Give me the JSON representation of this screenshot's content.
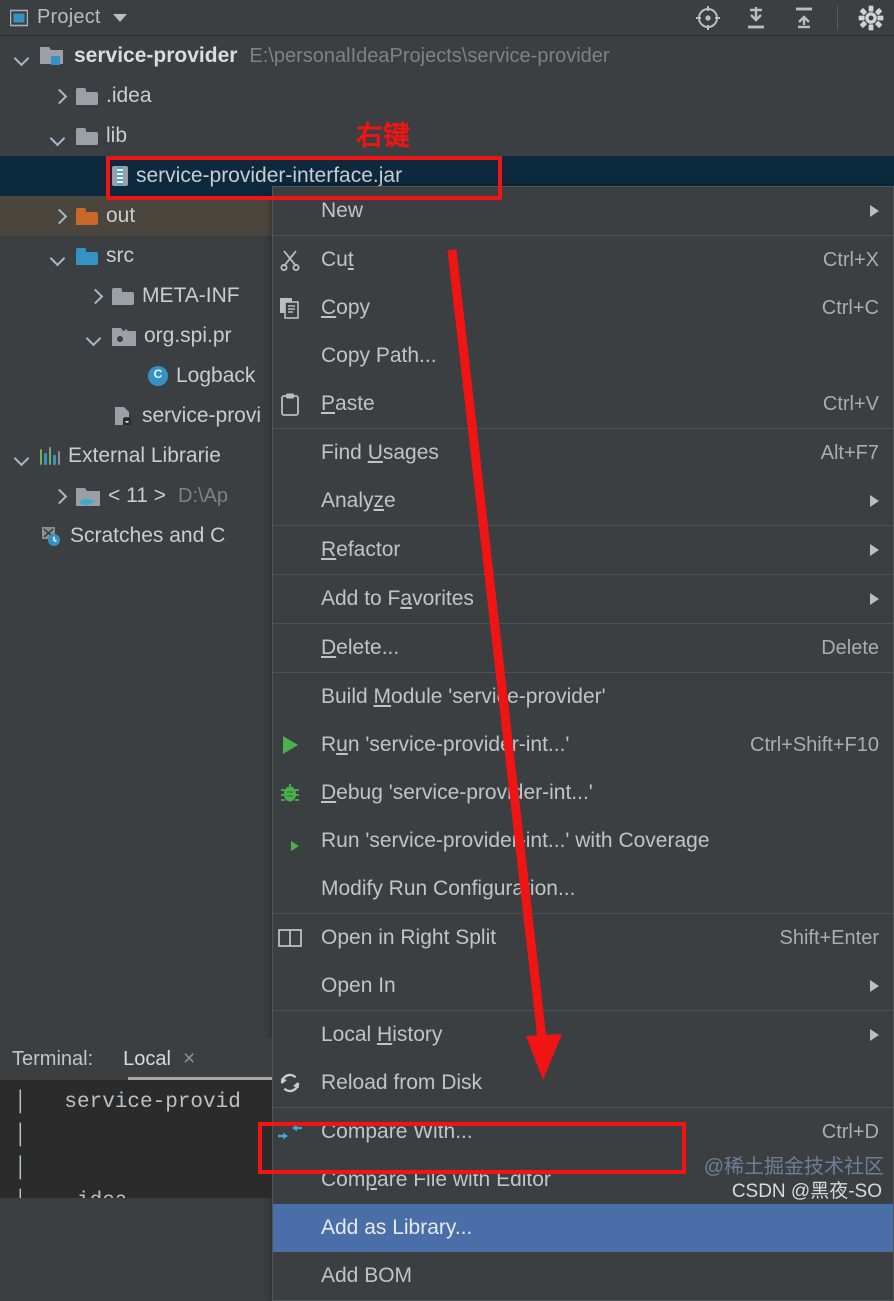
{
  "panel": {
    "title": "Project",
    "icon": "project-window-icon",
    "toolbar": [
      {
        "name": "locate-in-tree-icon",
        "label": "Select Opened File"
      },
      {
        "name": "expand-all-icon",
        "label": "Expand All"
      },
      {
        "name": "collapse-all-icon",
        "label": "Collapse All"
      },
      {
        "name": "settings-gear-icon",
        "label": "Options"
      }
    ]
  },
  "tree": [
    {
      "label": "service-provider",
      "secondary": "E:\\personalIdeaProjects\\service-provider",
      "indent": 0,
      "twisty": "down",
      "icon": "module-folder-icon",
      "bold": true,
      "squiggly": true
    },
    {
      "label": ".idea",
      "secondary": "",
      "indent": 1,
      "twisty": "right",
      "icon": "folder-icon",
      "bold": false,
      "squiggly": false
    },
    {
      "label": "lib",
      "secondary": "",
      "indent": 1,
      "twisty": "down",
      "icon": "folder-icon",
      "bold": false,
      "squiggly": false
    },
    {
      "label": "service-provider-interface.jar",
      "secondary": "",
      "indent": 2,
      "twisty": "none",
      "icon": "jar-file-icon",
      "bold": false,
      "squiggly": false,
      "selected": true
    },
    {
      "label": "out",
      "secondary": "",
      "indent": 1,
      "twisty": "right",
      "icon": "excluded-folder-icon",
      "bold": false,
      "squiggly": false,
      "highlighted": true
    },
    {
      "label": "src",
      "secondary": "",
      "indent": 1,
      "twisty": "down",
      "icon": "source-folder-icon",
      "bold": false,
      "squiggly": true
    },
    {
      "label": "META-INF",
      "secondary": "",
      "indent": 2,
      "twisty": "right",
      "icon": "folder-icon",
      "bold": false,
      "squiggly": false
    },
    {
      "label": "org.spi.pr",
      "secondary": "",
      "indent": 2,
      "twisty": "down",
      "icon": "package-folder-icon",
      "bold": false,
      "squiggly": true
    },
    {
      "label": "Logback",
      "secondary": "",
      "indent": 3,
      "twisty": "none",
      "icon": "java-class-icon",
      "bold": false,
      "squiggly": true
    },
    {
      "label": "service-provi",
      "secondary": "",
      "indent": 2,
      "twisty": "none",
      "icon": "module-iml-icon",
      "bold": false,
      "squiggly": false
    },
    {
      "label": "External Librarie",
      "secondary": "",
      "indent": 0,
      "twisty": "down",
      "icon": "external-libraries-icon",
      "bold": false,
      "squiggly": false
    },
    {
      "label": "< 11 >",
      "secondary": "D:\\Ap",
      "indent": 1,
      "twisty": "right",
      "icon": "jdk-folder-icon",
      "bold": false,
      "squiggly": false
    },
    {
      "label": "Scratches and C",
      "secondary": "",
      "indent": 0,
      "twisty": "none",
      "icon": "scratches-icon",
      "bold": false,
      "squiggly": false
    }
  ],
  "context_menu": [
    {
      "type": "item",
      "label": "New",
      "shortcut": "",
      "icon": "",
      "submenu": true
    },
    {
      "type": "separator"
    },
    {
      "type": "item",
      "label": "Cut",
      "shortcut": "Ctrl+X",
      "icon": "cut-icon",
      "submenu": false,
      "mnemonic_index": 2
    },
    {
      "type": "item",
      "label": "Copy",
      "shortcut": "Ctrl+C",
      "icon": "copy-icon",
      "submenu": false,
      "mnemonic_index": 0
    },
    {
      "type": "item",
      "label": "Copy Path...",
      "shortcut": "",
      "icon": "",
      "submenu": false
    },
    {
      "type": "item",
      "label": "Paste",
      "shortcut": "Ctrl+V",
      "icon": "paste-icon",
      "submenu": false,
      "mnemonic_index": 0
    },
    {
      "type": "separator"
    },
    {
      "type": "item",
      "label": "Find Usages",
      "shortcut": "Alt+F7",
      "icon": "",
      "submenu": false,
      "mnemonic_index": 5
    },
    {
      "type": "item",
      "label": "Analyze",
      "shortcut": "",
      "icon": "",
      "submenu": true,
      "mnemonic_index": 5
    },
    {
      "type": "separator"
    },
    {
      "type": "item",
      "label": "Refactor",
      "shortcut": "",
      "icon": "",
      "submenu": true,
      "mnemonic_index": 0
    },
    {
      "type": "separator"
    },
    {
      "type": "item",
      "label": "Add to Favorites",
      "shortcut": "",
      "icon": "",
      "submenu": true,
      "mnemonic_index": 8
    },
    {
      "type": "separator"
    },
    {
      "type": "item",
      "label": "Delete...",
      "shortcut": "Delete",
      "icon": "",
      "submenu": false,
      "mnemonic_index": 0
    },
    {
      "type": "separator"
    },
    {
      "type": "item",
      "label": "Build Module 'service-provider'",
      "shortcut": "",
      "icon": "",
      "submenu": false,
      "mnemonic_index": 6
    },
    {
      "type": "item",
      "label": "Run 'service-provider-int...'",
      "shortcut": "Ctrl+Shift+F10",
      "icon": "run-icon",
      "submenu": false,
      "mnemonic_index": 1
    },
    {
      "type": "item",
      "label": "Debug 'service-provider-int...'",
      "shortcut": "",
      "icon": "debug-icon",
      "submenu": false,
      "mnemonic_index": 0
    },
    {
      "type": "item",
      "label": "Run 'service-provider-int...' with Coverage",
      "shortcut": "",
      "icon": "coverage-icon",
      "submenu": false
    },
    {
      "type": "item",
      "label": "Modify Run Configuration...",
      "shortcut": "",
      "icon": "",
      "submenu": false
    },
    {
      "type": "separator"
    },
    {
      "type": "item",
      "label": "Open in Right Split",
      "shortcut": "Shift+Enter",
      "icon": "split-icon",
      "submenu": false
    },
    {
      "type": "item",
      "label": "Open In",
      "shortcut": "",
      "icon": "",
      "submenu": true
    },
    {
      "type": "separator"
    },
    {
      "type": "item",
      "label": "Local History",
      "shortcut": "",
      "icon": "",
      "submenu": true,
      "mnemonic_index": 6
    },
    {
      "type": "item",
      "label": "Reload from Disk",
      "shortcut": "",
      "icon": "reload-icon",
      "submenu": false
    },
    {
      "type": "separator"
    },
    {
      "type": "item",
      "label": "Compare With...",
      "shortcut": "Ctrl+D",
      "icon": "compare-icon",
      "submenu": false
    },
    {
      "type": "item",
      "label": "Compare File with Editor",
      "shortcut": "",
      "icon": "",
      "submenu": false,
      "mnemonic_index": 3
    },
    {
      "type": "item",
      "label": "Add as Library...",
      "shortcut": "",
      "icon": "",
      "submenu": false,
      "selected": true
    },
    {
      "type": "item",
      "label": "Add BOM",
      "shortcut": "",
      "icon": "",
      "submenu": false
    }
  ],
  "terminal": {
    "label": "Terminal:",
    "tab": "Local",
    "close": "×",
    "lines": [
      "│   service-provid",
      "│",
      "│",
      "└── .idea"
    ]
  },
  "annotations": {
    "right_click_text": "右键",
    "watermark_gold": "@稀土掘金技术社区",
    "watermark_csdn": "CSDN @黑夜-SO"
  },
  "colors": {
    "panel_bg": "#3c3f41",
    "selection_blue": "#4a6fa8",
    "tree_selection": "#0d293e",
    "annotation_red": "#f01414",
    "excluded_folder": "#c8682b",
    "source_folder": "#3592c4"
  }
}
